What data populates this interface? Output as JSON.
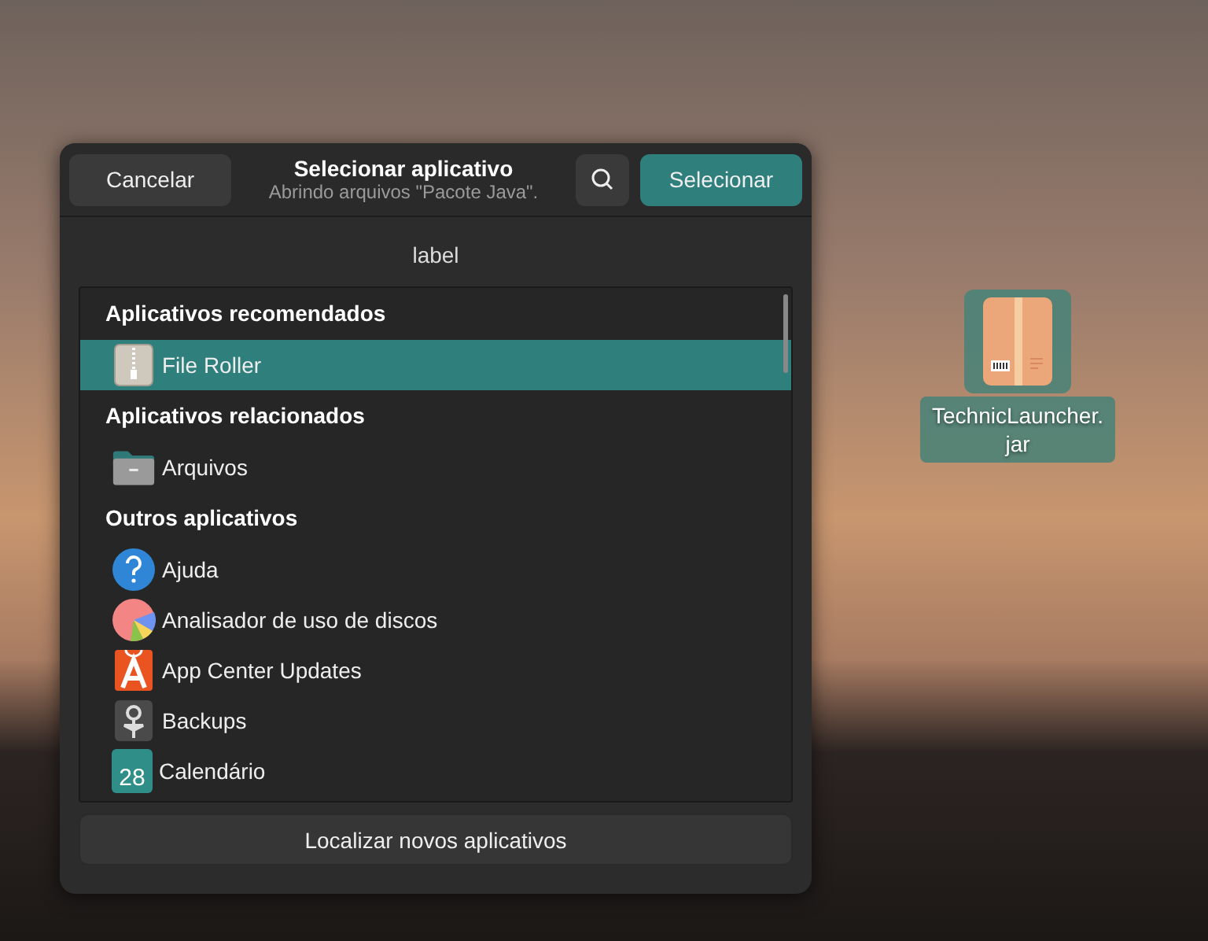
{
  "desktop_icon": {
    "label_lines": [
      "TechnicLauncher.",
      "jar"
    ],
    "selected": true
  },
  "dialog": {
    "title": "Selecionar aplicativo",
    "subtitle": "Abrindo arquivos \"Pacote Java\".",
    "cancel_button": "Cancelar",
    "select_button": "Selecionar",
    "label": "label",
    "sections": [
      {
        "heading": "Aplicativos recomendados",
        "apps": [
          {
            "name": "File Roller",
            "kind": "archive",
            "selected": true
          }
        ]
      },
      {
        "heading": "Aplicativos relacionados",
        "apps": [
          {
            "name": "Arquivos",
            "kind": "folder",
            "selected": false
          }
        ]
      },
      {
        "heading": "Outros aplicativos",
        "apps": [
          {
            "name": "Ajuda",
            "kind": "help",
            "selected": false
          },
          {
            "name": "Analisador de uso de discos",
            "kind": "disk-usage",
            "selected": false
          },
          {
            "name": "App Center Updates",
            "kind": "app-center",
            "selected": false
          },
          {
            "name": "Backups",
            "kind": "backups",
            "selected": false
          },
          {
            "name": "Calendário",
            "kind": "calendar",
            "icon_text": "28",
            "selected": false
          }
        ]
      }
    ],
    "footer_button": "Localizar novos aplicativos"
  }
}
